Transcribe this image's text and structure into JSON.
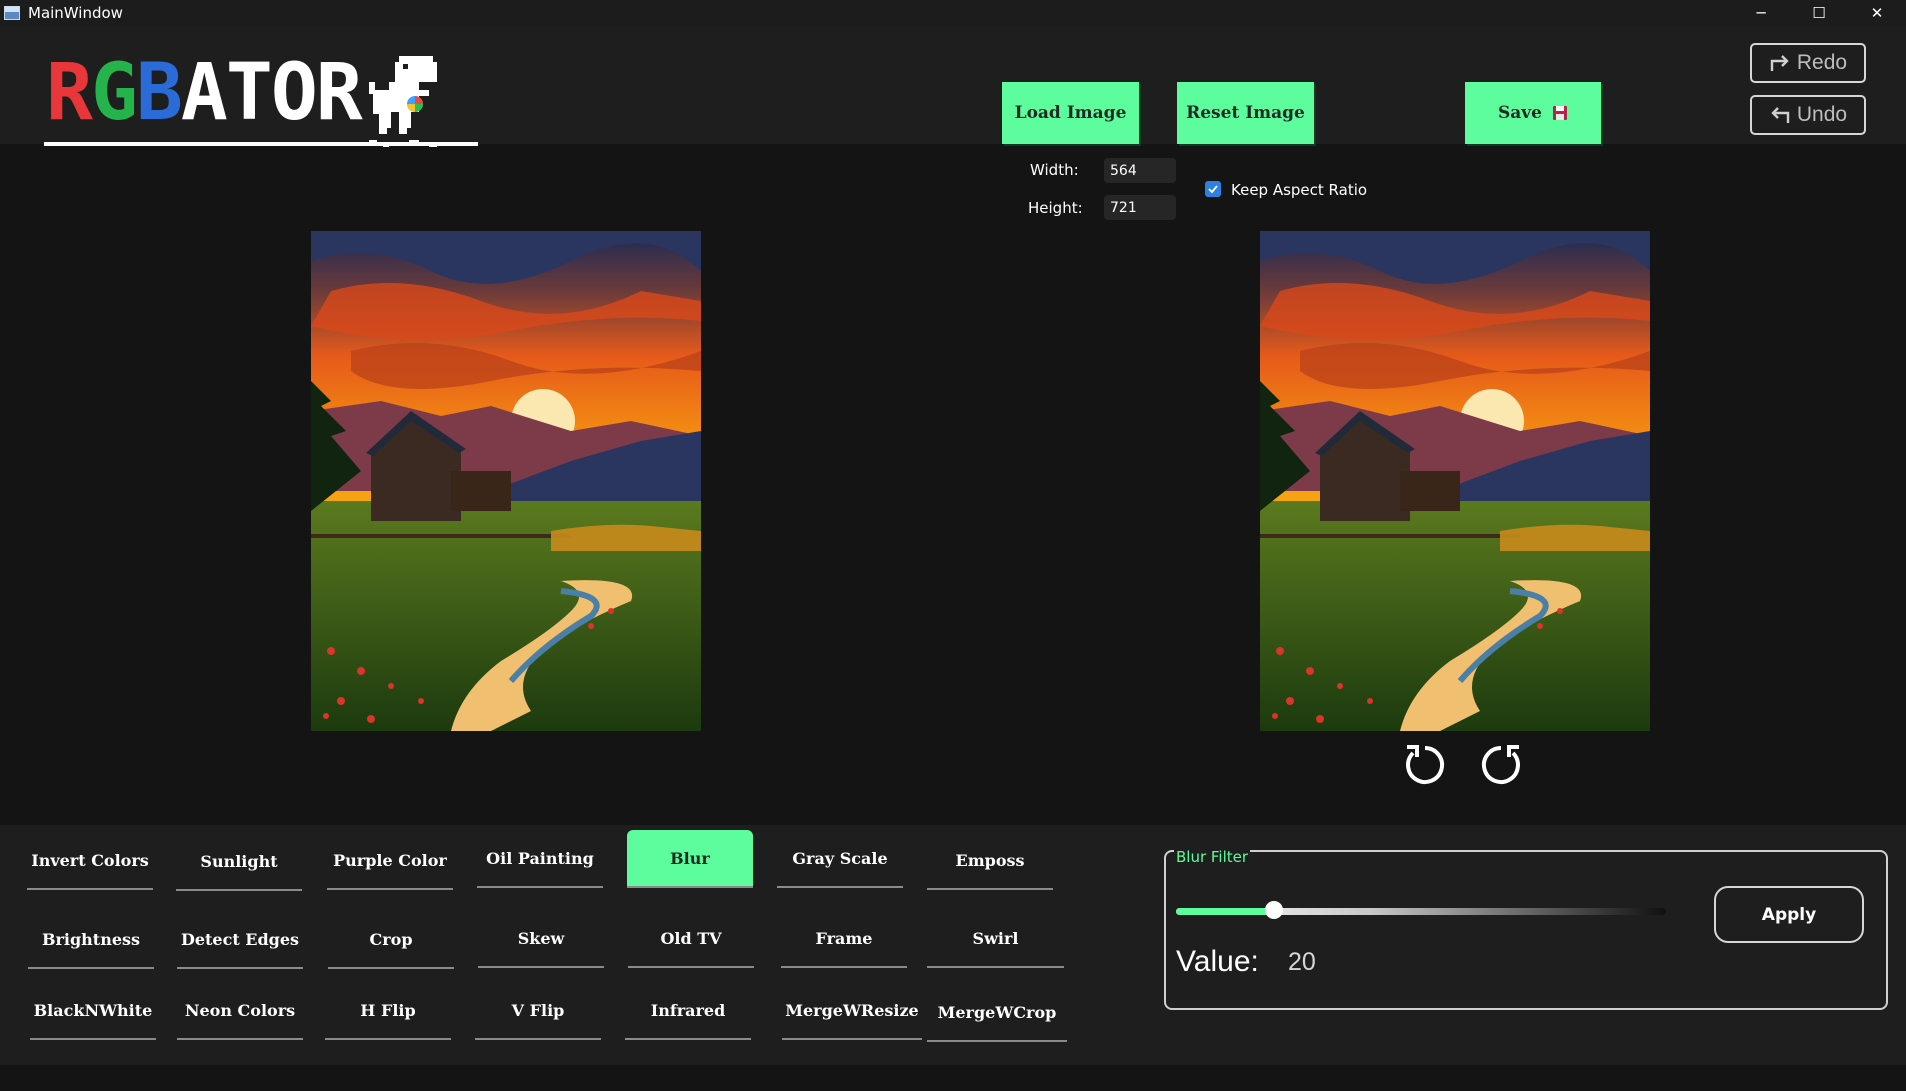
{
  "window": {
    "title": "MainWindow",
    "minimize": "─",
    "maximize": "☐",
    "close": "✕"
  },
  "logo": {
    "r": "R",
    "g": "G",
    "b": "B",
    "rest": "ATOR"
  },
  "toolbar": {
    "load": "Load Image",
    "reset": "Reset Image",
    "save": "Save",
    "redo": "Redo",
    "undo": "Undo"
  },
  "dimensions": {
    "width_label": "Width:",
    "width_value": "564",
    "height_label": "Height:",
    "height_value": "721",
    "keep_aspect": "Keep Aspect Ratio",
    "keep_aspect_checked": true
  },
  "filters": {
    "row1": [
      "Invert Colors",
      "Sunlight",
      "Purple Color",
      "Oil Painting",
      "Blur",
      "Gray Scale",
      "Emposs"
    ],
    "row2": [
      "Brightness",
      "Detect Edges",
      "Crop",
      "Skew",
      "Old TV",
      "Frame",
      "Swirl"
    ],
    "row3": [
      "BlackNWhite",
      "Neon Colors",
      "H Flip",
      "V Flip",
      "Infrared",
      "MergeWResize",
      "MergeWCrop"
    ],
    "active": "Blur"
  },
  "blur_panel": {
    "title": "Blur Filter",
    "value_label": "Value:",
    "value": "20",
    "slider_fraction": 0.2,
    "apply": "Apply"
  },
  "colors": {
    "accent": "#5dfc9c",
    "background": "#141414",
    "panel": "#1e1e1e"
  }
}
